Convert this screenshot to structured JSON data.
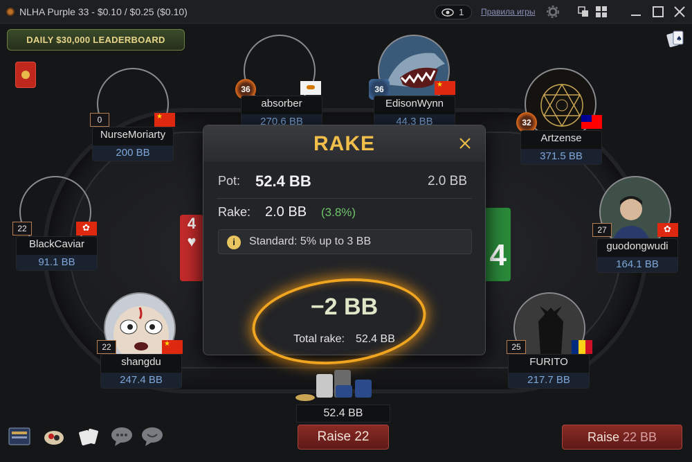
{
  "window": {
    "title": "NLHA Purple 33 - $0.10 / $0.25 ($0.10)",
    "observers": "1",
    "rules_link": "Правила игры"
  },
  "leaderboard": {
    "label": "DAILY $30,000 LEADERBOARD"
  },
  "players": [
    {
      "name": "NurseMoriarty",
      "stack": "200 BB",
      "level": "0",
      "flag": "cn"
    },
    {
      "name": "absorber",
      "stack": "270.6 BB",
      "badge": "36",
      "flag": "cy"
    },
    {
      "name": "EdisonWynn",
      "stack": "44.3 BB",
      "badge": "36",
      "flag": "cn"
    },
    {
      "name": "Artzense",
      "stack": "371.5 BB",
      "badge": "32",
      "flag": "tw"
    },
    {
      "name": "BlackCaviar",
      "stack": "91.1 BB",
      "level": "22",
      "flag": "hk"
    },
    {
      "name": "guodongwudi",
      "stack": "164.1 BB",
      "level": "27",
      "flag": "hk"
    },
    {
      "name": "shangdu",
      "stack": "247.4 BB",
      "level": "22",
      "flag": "cn"
    },
    {
      "name": "FURITO",
      "stack": "217.7 BB",
      "level": "25",
      "flag": "ro"
    }
  ],
  "cards": {
    "left_rank": "4",
    "left_suit": "♥",
    "right_rank": "4"
  },
  "rake_modal": {
    "title": "RAKE",
    "pot_label": "Pot:",
    "pot_value": "52.4 BB",
    "pot_right": "2.0 BB",
    "rake_label": "Rake:",
    "rake_value": "2.0 BB",
    "rake_pct": "(3.8%)",
    "info_icon": "i",
    "info_text": "Standard: 5% up to 3 BB",
    "big_value": "−2 BB",
    "total_label": "Total rake:",
    "total_value": "52.4 BB"
  },
  "pot": {
    "value": "52.4 BB"
  },
  "actions": {
    "raise_label": "Raise 22",
    "raise2_label": "Raise",
    "raise2_amount": "22 BB"
  },
  "colors": {
    "accent_gold": "#f2c04a",
    "raise_red": "#8a2a25",
    "stack_blue": "#7ea7d8",
    "rake_green": "#6fc46a"
  }
}
